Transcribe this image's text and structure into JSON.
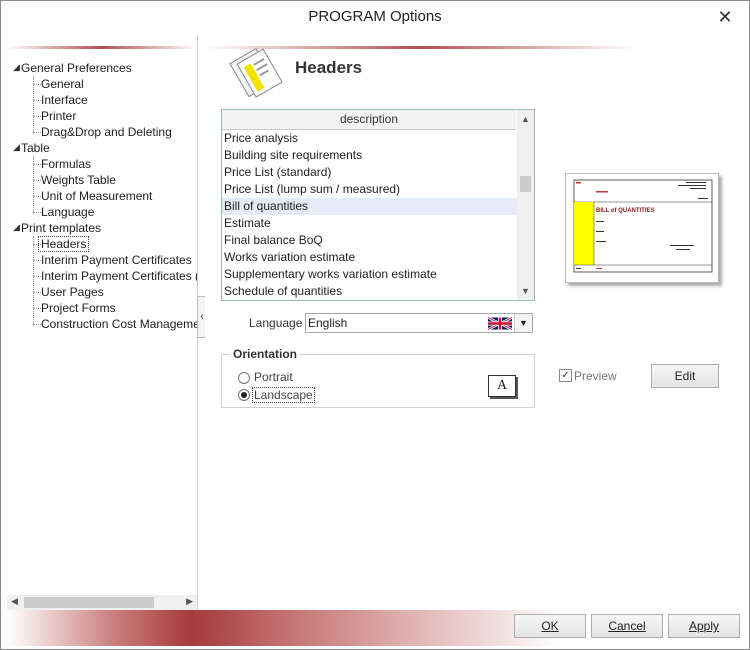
{
  "window": {
    "title": "PROGRAM Options",
    "close_glyph": "✕"
  },
  "tree": {
    "nodes": [
      {
        "label": "General Preferences",
        "level": 0
      },
      {
        "label": "General",
        "level": 1
      },
      {
        "label": "Interface",
        "level": 1
      },
      {
        "label": "Printer",
        "level": 1
      },
      {
        "label": "Drag&Drop and Deleting",
        "level": 1
      },
      {
        "label": "Table",
        "level": 0
      },
      {
        "label": "Formulas",
        "level": 1
      },
      {
        "label": "Weights Table",
        "level": 1
      },
      {
        "label": "Unit of Measurement",
        "level": 1
      },
      {
        "label": "Language",
        "level": 1
      },
      {
        "label": "Print templates",
        "level": 0
      },
      {
        "label": "Headers",
        "level": 1,
        "selected": true
      },
      {
        "label": "Interim Payment Certificates",
        "level": 1
      },
      {
        "label": "Interim Payment Certificates (E",
        "level": 1
      },
      {
        "label": "User Pages",
        "level": 1
      },
      {
        "label": "Project Forms",
        "level": 1
      },
      {
        "label": "Construction Cost Managemen",
        "level": 1
      }
    ]
  },
  "panel": {
    "title": "Headers"
  },
  "list": {
    "header": "description",
    "items": [
      "Price analysis",
      "Building site requirements",
      "Price List (standard)",
      "Price List (lump sum / measured)",
      "Bill of quantities",
      "Estimate",
      "Final balance BoQ",
      "Works variation estimate",
      "Supplementary works variation estimate",
      "Schedule of quantities"
    ],
    "selected_index": 4
  },
  "language": {
    "label": "Language",
    "value": "English",
    "flag_icon": "uk-flag-icon"
  },
  "orientation": {
    "title": "Orientation",
    "portrait_label": "Portrait",
    "landscape_label": "Landscape",
    "selected": "Landscape",
    "icon_glyph": "A"
  },
  "preview": {
    "checkbox_label": "Preview",
    "checked": true,
    "check_glyph": "✓",
    "doc_title": "BILL of QUANTITIES",
    "edit_label": "Edit"
  },
  "buttons": {
    "ok": "OK",
    "cancel": "Cancel",
    "apply": "Apply"
  },
  "colors": {
    "accent": "#a53a3a",
    "highlight_yellow": "#ffff00",
    "selection": "#e5ecf7"
  }
}
